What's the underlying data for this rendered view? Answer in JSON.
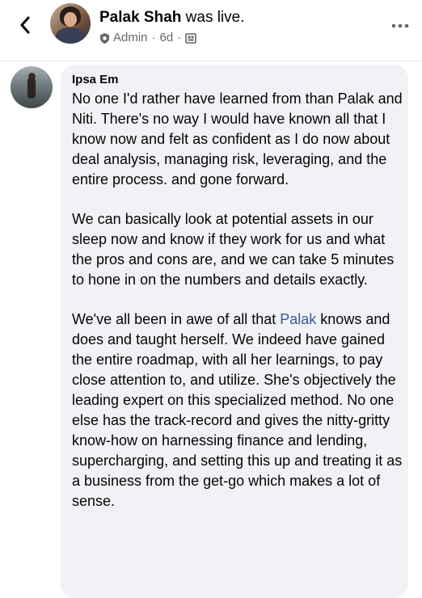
{
  "header": {
    "author_name": "Palak Shah",
    "title_suffix": " was live.",
    "role": "Admin",
    "separator": "·",
    "time_ago": "6d",
    "icons": {
      "back": "chevron-left-icon",
      "role": "admin-shield-icon",
      "audience": "group-audience-icon",
      "more": "more-options-icon"
    }
  },
  "comment": {
    "author": "Ipsa Em",
    "paragraph_1": "No one I'd rather have learned from than Palak and Niti. There's no way I would have known all that I know now and felt as confident as I do now about deal analysis, managing risk, leveraging, and the entire process. and gone forward.",
    "paragraph_2": "We can basically look at potential assets in our sleep now and know if they work for us and what the pros and cons are, and we can take 5 minutes to hone in on the numbers and details exactly.",
    "paragraph_3_before": "We've all been in awe of all that ",
    "paragraph_3_mention": "Palak",
    "paragraph_3_after": " knows and does and taught herself. We indeed have gained the entire roadmap, with all her learnings, to pay close attention to, and utilize. She's objectively the leading expert on this specialized method. No one else has the track-record and gives the nitty-gritty know-how on harnessing finance and lending, supercharging, and setting this up and treating it as a business from the get-go which makes a lot of sense."
  },
  "colors": {
    "bubble": "#f0f2f5",
    "text": "#050505",
    "secondary_text": "#65676b",
    "mention": "#385898"
  }
}
